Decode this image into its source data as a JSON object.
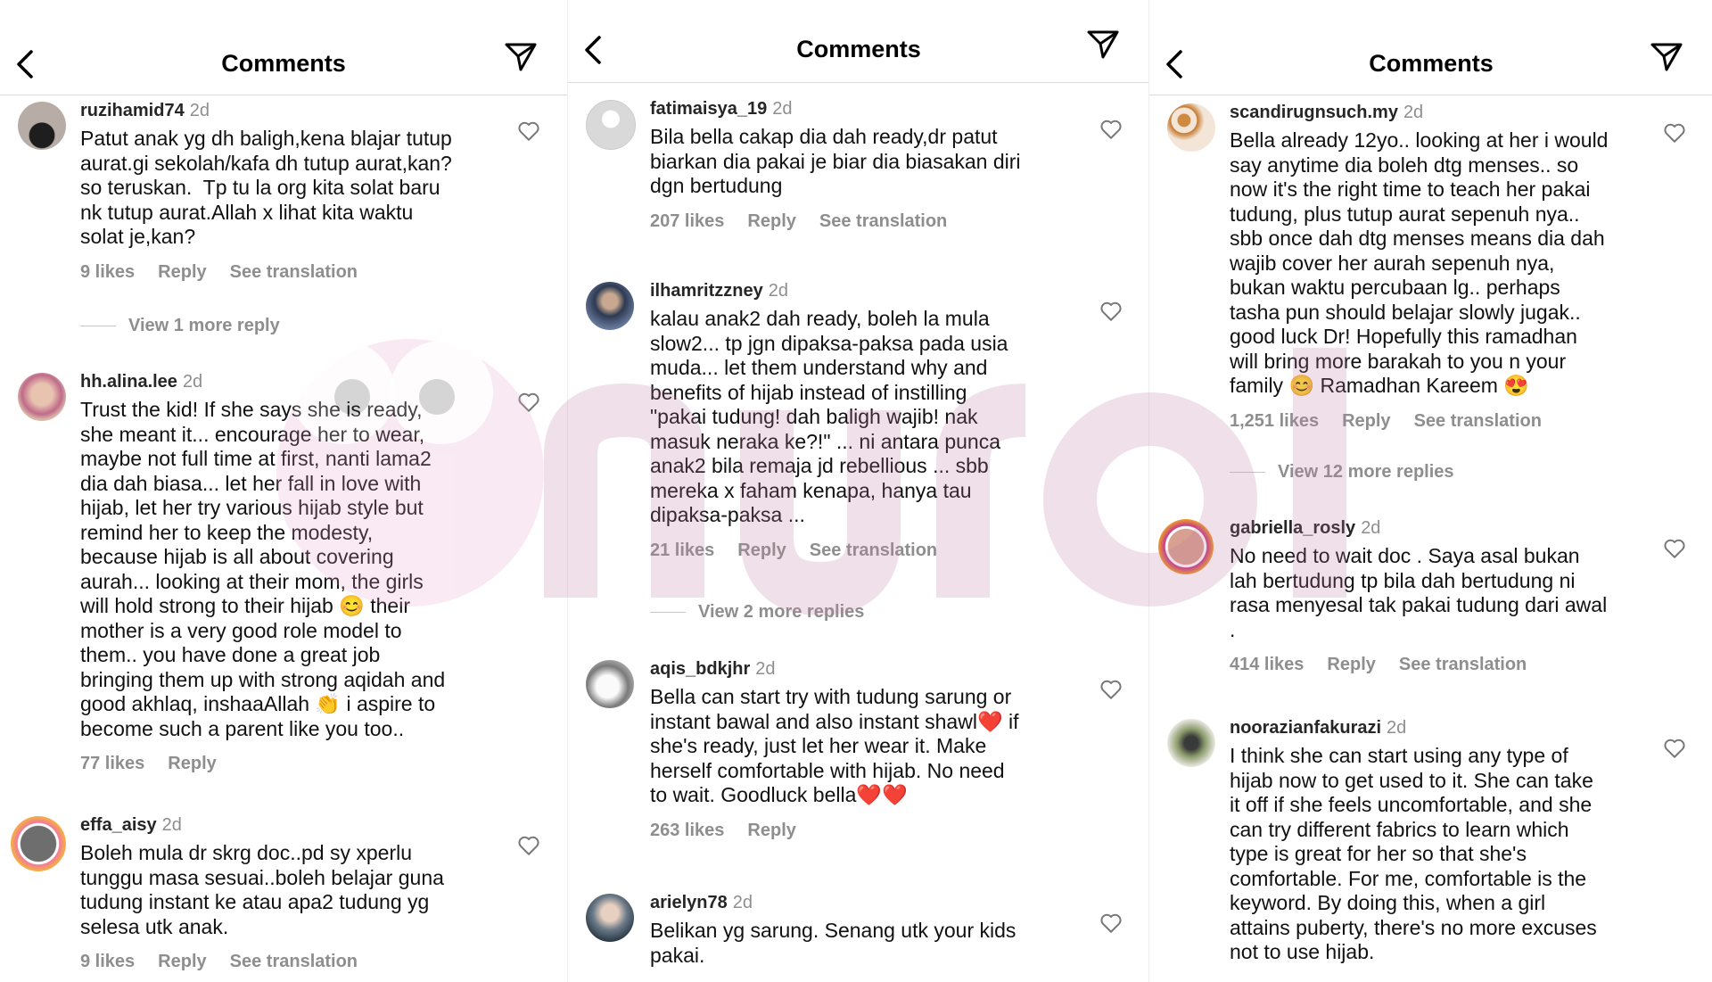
{
  "panels": [
    {
      "title": "Comments",
      "comments": [
        {
          "username": "ruzihamid74",
          "time": "2d",
          "text": "Patut anak yg dh baligh,kena blajar tutup\naurat.gi sekolah/kafa dh tutup aurat,kan?\nso teruskan.  Tp tu la org kita solat baru\nnk tutup aurat.Allah x lihat kita waktu\nsolat je,kan?",
          "likes": "9 likes",
          "reply": "Reply",
          "translate": "See translation",
          "avatar_color": "#5a4a45"
        },
        {
          "username": "hh.alina.lee",
          "time": "2d",
          "text": "Trust the kid! If she says she is ready,\nshe meant it... encourage her to wear,\nmaybe not full time at first, nanti lama2\ndia dah biasa... let her fall in love with\nhijab, let her try various hijab style but\nremind her to keep the modesty,\nbecause hijab is all about covering\naurah... looking at their mom, the girls\nwill hold strong to their hijab 😊 their\nmother is a very good role model to\nthem.. you have done a great job\nbringing them up with strong aqidah and\ngood akhlaq, inshaaAllah 👏 i aspire to\nbecome such a parent like you too..",
          "likes": "77 likes",
          "reply": "Reply",
          "translate": "",
          "avatar_color": "#c9a08a"
        },
        {
          "username": "effa_aisy",
          "time": "2d",
          "text": "Boleh mula dr skrg doc..pd sy xperlu\ntunggu masa sesuai..boleh belajar guna\ntudung instant ke atau apa2 tudung yg\nselesa utk anak.",
          "likes": "9 likes",
          "reply": "Reply",
          "translate": "See translation",
          "avatar_color": "#8a8a8a"
        }
      ],
      "view_more": "View 1 more reply"
    },
    {
      "title": "Comments",
      "comments": [
        {
          "username": "fatimaisya_19",
          "time": "2d",
          "text": "Bila bella cakap dia dah ready,dr patut\nbiarkan dia pakai je biar dia biasakan diri\ndgn bertudung",
          "likes": "207 likes",
          "reply": "Reply",
          "translate": "See translation",
          "avatar_color": "#d9d9d9"
        },
        {
          "username": "ilhamritzzney",
          "time": "2d",
          "text": "kalau anak2 dah ready, boleh la mula\nslow2... tp jgn dipaksa-paksa pada usia\nmuda... let them understand why and\nbenefits of hijab instead of instilling\n\"pakai tudung! dah baligh wajib! nak\nmasuk neraka ke?!\" ... ni antara punca\nanak2 bila remaja jd rebellious ... sbb\nmereka x faham kenapa, hanya tau\ndipaksa-paksa ...",
          "likes": "21 likes",
          "reply": "Reply",
          "translate": "See translation",
          "avatar_color": "#3f4a5e"
        },
        {
          "username": "aqis_bdkjhr",
          "time": "2d",
          "text": "Bella can start try with tudung sarung or\ninstant bawal and also instant shawl❤️ if\nshe's ready, just let her wear it. Make\nherself comfortable with hijab. No need\nto wait. Goodluck bella❤️❤️",
          "likes": "263 likes",
          "reply": "Reply",
          "translate": "",
          "avatar_color": "#b8b8b8"
        },
        {
          "username": "arielyn78",
          "time": "2d",
          "text": "Belikan yg sarung. Senang utk your kids\npakai.",
          "likes": "",
          "reply": "",
          "translate": "",
          "avatar_color": "#4a5a6a"
        }
      ],
      "view_more": "View 2 more replies"
    },
    {
      "title": "Comments",
      "comments": [
        {
          "username": "scandirugnsuch.my",
          "time": "2d",
          "text": "Bella already 12yo.. looking at her i would\nsay anytime dia boleh dtg menses.. so\nnow it's the right time to teach her pakai\ntudung, plus tutup aurat sepenuh nya..\nsbb once dah dtg menses means dia dah\nwajib cover her aurah sepenuh nya,\nbukan waktu percubaan lg.. perhaps\ntasha pun should belajar slowly jugak..\ngood luck Dr! Hopefully this ramadhan\nwill bring more barakah to you n your\nfamily 😊 Ramadhan Kareem 😍",
          "likes": "1,251 likes",
          "reply": "Reply",
          "translate": "See translation",
          "avatar_color": "#d9a066"
        },
        {
          "username": "gabriella_rosly",
          "time": "2d",
          "text": "No need to wait doc . Saya asal bukan\nlah bertudung tp bila dah bertudung ni\nrasa menyesal tak pakai tudung dari awal\n.",
          "likes": "414 likes",
          "reply": "Reply",
          "translate": "See translation",
          "avatar_color": "#c98a7a"
        },
        {
          "username": "noorazianfakurazi",
          "time": "2d",
          "text": "I think she can start using any type of\nhijab now to get used to it. She can take\nit off if she feels uncomfortable, and she\ncan try different fabrics to learn which\ntype is great for her so that she's\ncomfortable. For me, comfortable is the\nkeyword. By doing this, when a girl\nattains puberty, there's no more excuses\nnot to use hijab.",
          "likes": "",
          "reply": "",
          "translate": "",
          "avatar_color": "#6a7a5a"
        }
      ],
      "view_more": "View 12 more replies"
    }
  ],
  "icons": {
    "back": "chevron-left-icon",
    "send": "paper-plane-icon",
    "like": "heart-outline-icon"
  },
  "colors": {
    "text": "#262626",
    "muted": "#8e8e8e",
    "watermark": "#e8a0c8"
  }
}
